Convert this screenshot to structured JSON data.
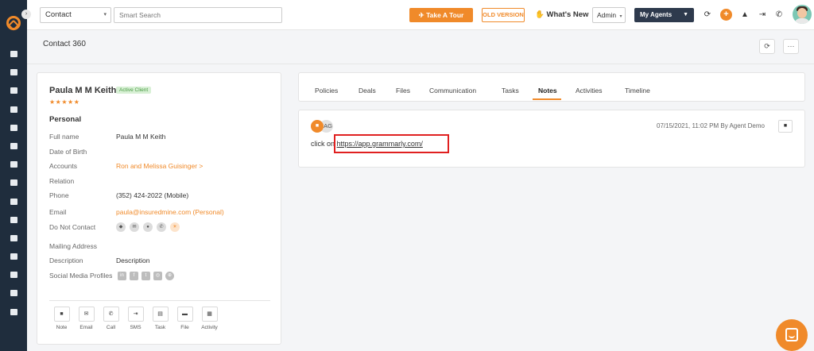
{
  "topbar": {
    "contact_select": "Contact",
    "search_placeholder": "Smart Search",
    "take_tour": "Take A Tour",
    "old_version": "OLD VERSION",
    "whats_new": "What's New",
    "admin_select": "Admin",
    "my_agents": "My Agents",
    "plus": "+"
  },
  "page": {
    "title": "Contact 360"
  },
  "contact": {
    "name": "Paula M M Keith",
    "badge": "Active Client",
    "stars": "★★★★★",
    "section": "Personal",
    "fields": {
      "full_name_label": "Full name",
      "full_name_value": "Paula M M Keith",
      "dob_label": "Date of Birth",
      "accounts_label": "Accounts",
      "accounts_value": "Ron and Melissa Guisinger >",
      "relation_label": "Relation",
      "phone_label": "Phone",
      "phone_value": "(352) 424-2022 (Mobile)",
      "email_label": "Email",
      "email_value": "paula@insuredmine.com  (Personal)",
      "dnc_label": "Do Not Contact",
      "mailing_label": "Mailing Address",
      "description_label": "Description",
      "description_value": "Description",
      "social_label": "Social Media Profiles"
    },
    "actions": [
      "Note",
      "Email",
      "Call",
      "SMS",
      "Task",
      "File",
      "Activity"
    ]
  },
  "tabs": [
    "Policies",
    "Deals",
    "Files",
    "Communication",
    "Tasks",
    "Notes",
    "Activities",
    "Timeline"
  ],
  "active_tab": "Notes",
  "note": {
    "initials": "AG",
    "meta": "07/15/2021, 11:02 PM   By Agent Demo",
    "text_prefix": "click on",
    "link": "https://app.grammarly.com/"
  },
  "colors": {
    "accent": "#f08a2a",
    "rail": "#1f2d3d",
    "highlight": "#e02020"
  }
}
